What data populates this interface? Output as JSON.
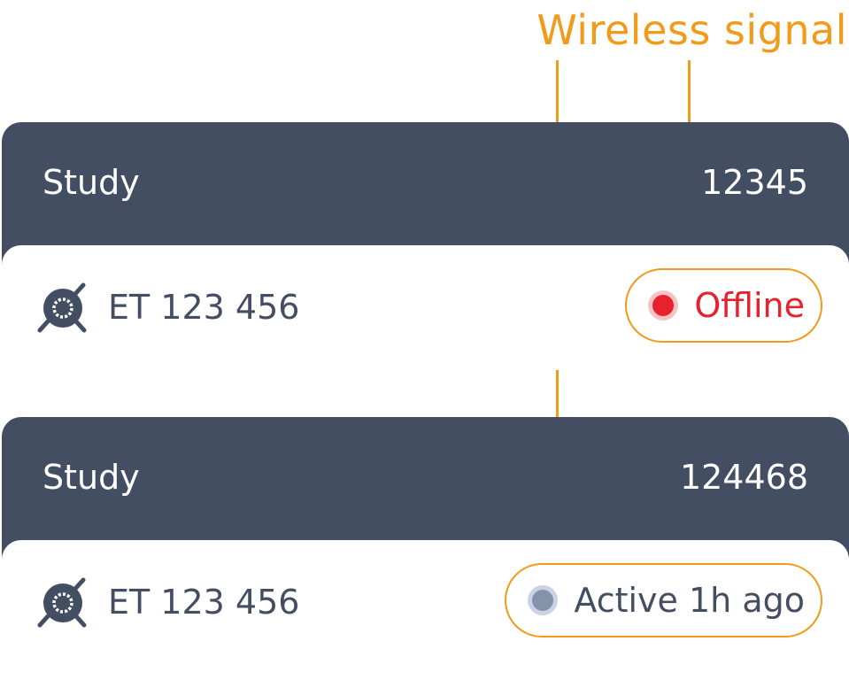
{
  "annotation": {
    "label": "Wireless signal",
    "color": "#F29A1A"
  },
  "colors": {
    "header_bg": "#444E63",
    "text_dark": "#444E63",
    "offline": "#E8222D",
    "inactive": "#8593AA"
  },
  "cards": [
    {
      "header_title": "Study",
      "header_number": "12345",
      "device_icon": "eye-tracker-icon",
      "device_label": "ET 123 456",
      "status": "Offline",
      "status_state": "offline"
    },
    {
      "header_title": "Study",
      "header_number": "124468",
      "device_icon": "eye-tracker-icon",
      "device_label": "ET 123 456",
      "status": "Active 1h ago",
      "status_state": "inactive"
    }
  ]
}
